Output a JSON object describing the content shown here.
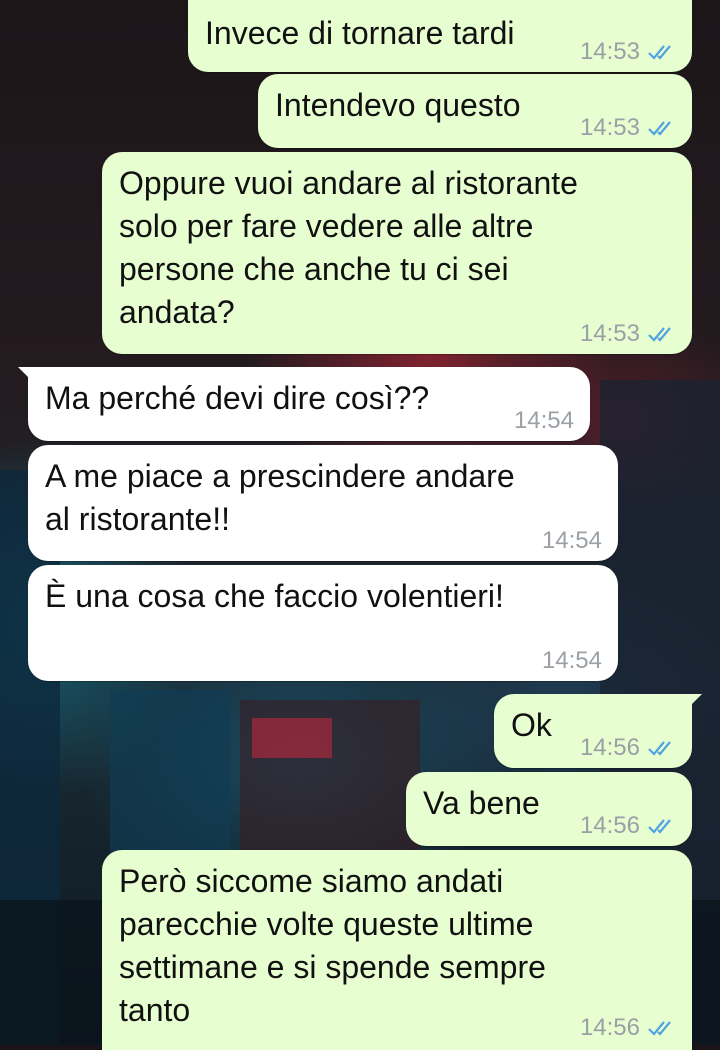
{
  "colors": {
    "outgoing_bubble": "#e7fed0",
    "incoming_bubble": "#ffffff",
    "timestamp": "#9aa0a6",
    "read_ticks": "#4fa3e0"
  },
  "messages": [
    {
      "direction": "outgoing",
      "text": "Invece di tornare tardi",
      "time": "14:53",
      "status": "read",
      "status_icon": "double-check-icon"
    },
    {
      "direction": "outgoing",
      "text": "Intendevo questo",
      "time": "14:53",
      "status": "read",
      "status_icon": "double-check-icon"
    },
    {
      "direction": "outgoing",
      "text": "Oppure vuoi andare al ristorante\nsolo per fare vedere alle altre\npersone che anche tu ci sei\nandata?",
      "time": "14:53",
      "status": "read",
      "status_icon": "double-check-icon"
    },
    {
      "direction": "incoming",
      "text": "Ma perché devi dire così??",
      "time": "14:54"
    },
    {
      "direction": "incoming",
      "text": "A me piace a prescindere andare\nal ristorante!!",
      "time": "14:54"
    },
    {
      "direction": "incoming",
      "text": "È una cosa che faccio volentieri!",
      "time": "14:54"
    },
    {
      "direction": "outgoing",
      "text": "Ok",
      "time": "14:56",
      "status": "read",
      "status_icon": "double-check-icon"
    },
    {
      "direction": "outgoing",
      "text": "Va bene",
      "time": "14:56",
      "status": "read",
      "status_icon": "double-check-icon"
    },
    {
      "direction": "outgoing",
      "text": "Però siccome siamo andati\nparecchie volte queste ultime\nsettimane e si spende sempre\ntanto",
      "time": "14:56",
      "status": "read",
      "status_icon": "double-check-icon"
    }
  ]
}
